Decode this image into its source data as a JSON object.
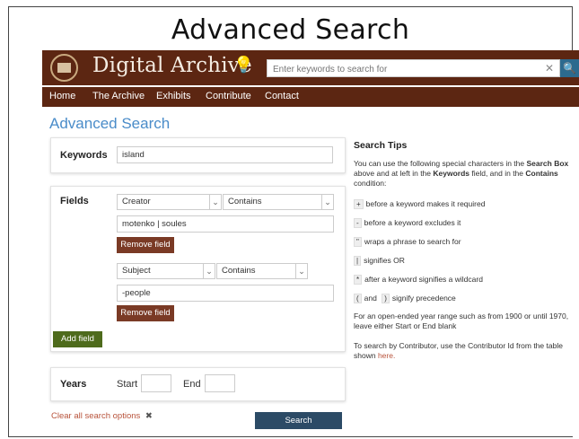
{
  "slide": {
    "title": "Advanced Search"
  },
  "site": {
    "brand": "Digital Archive",
    "search_placeholder": "Enter keywords to search for",
    "nav": [
      "Home",
      "The Archive",
      "Exhibits",
      "Contribute",
      "Contact"
    ]
  },
  "page": {
    "heading": "Advanced Search"
  },
  "keywords": {
    "label": "Keywords",
    "value": "island"
  },
  "fields": {
    "label": "Fields",
    "rows": [
      {
        "field": "Creator",
        "operator": "Contains",
        "value": "motenko | soules",
        "remove_label": "Remove field"
      },
      {
        "field": "Subject",
        "operator": "Contains",
        "value": "-people",
        "remove_label": "Remove field"
      }
    ],
    "add_label": "Add field"
  },
  "years": {
    "label": "Years",
    "start_label": "Start",
    "end_label": "End",
    "start_value": "",
    "end_value": ""
  },
  "actions": {
    "clear_label": "Clear all search options",
    "clear_icon": "✖",
    "search_label": "Search"
  },
  "tips": {
    "heading": "Search Tips",
    "intro_parts": [
      "You can use the following special characters in the ",
      "Search Box",
      " above and at left in the ",
      "Keywords",
      " field, and in the ",
      "Contains",
      " condition:"
    ],
    "items": [
      {
        "symbol": "+",
        "text": "before a keyword makes it required"
      },
      {
        "symbol": "-",
        "text": "before a keyword excludes it"
      },
      {
        "symbol": "\"",
        "text": "wraps a phrase to search for"
      },
      {
        "symbol": "|",
        "text": "signifies OR"
      },
      {
        "symbol": "*",
        "text": "after a keyword signifies a wildcard"
      }
    ],
    "precedence": {
      "open": "(",
      "and": "and",
      "close": ")",
      "text": "signify precedence"
    },
    "year_range": "For an open-ended year range such as from 1900 or until 1970, leave either Start or End blank",
    "contributor_text": "To search by Contributor, use the Contributor Id from the table shown ",
    "contributor_link": "here."
  },
  "colors": {
    "banner": "#5c2612",
    "heading": "#4a8cc9",
    "remove": "#7a3a25",
    "add": "#4e6b1c",
    "search": "#2c4b66"
  }
}
